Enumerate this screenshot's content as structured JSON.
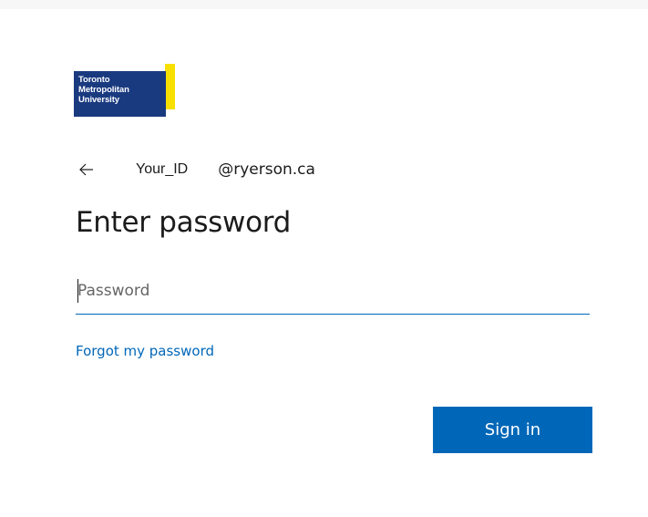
{
  "logo": {
    "text": "Toronto\nMetropolitan\nUniversity",
    "colors": {
      "blue": "#1a3a80",
      "yellow": "#f7e000"
    }
  },
  "identity": {
    "back_icon": "back-arrow-icon",
    "user_id": "Your_ID",
    "domain": "@ryerson.ca"
  },
  "page": {
    "title": "Enter password"
  },
  "password": {
    "placeholder": "Password",
    "value": ""
  },
  "links": {
    "forgot_password": "Forgot my password"
  },
  "actions": {
    "sign_in": "Sign in"
  },
  "theme": {
    "accent": "#0067b8",
    "text": "#1b1b1b"
  }
}
